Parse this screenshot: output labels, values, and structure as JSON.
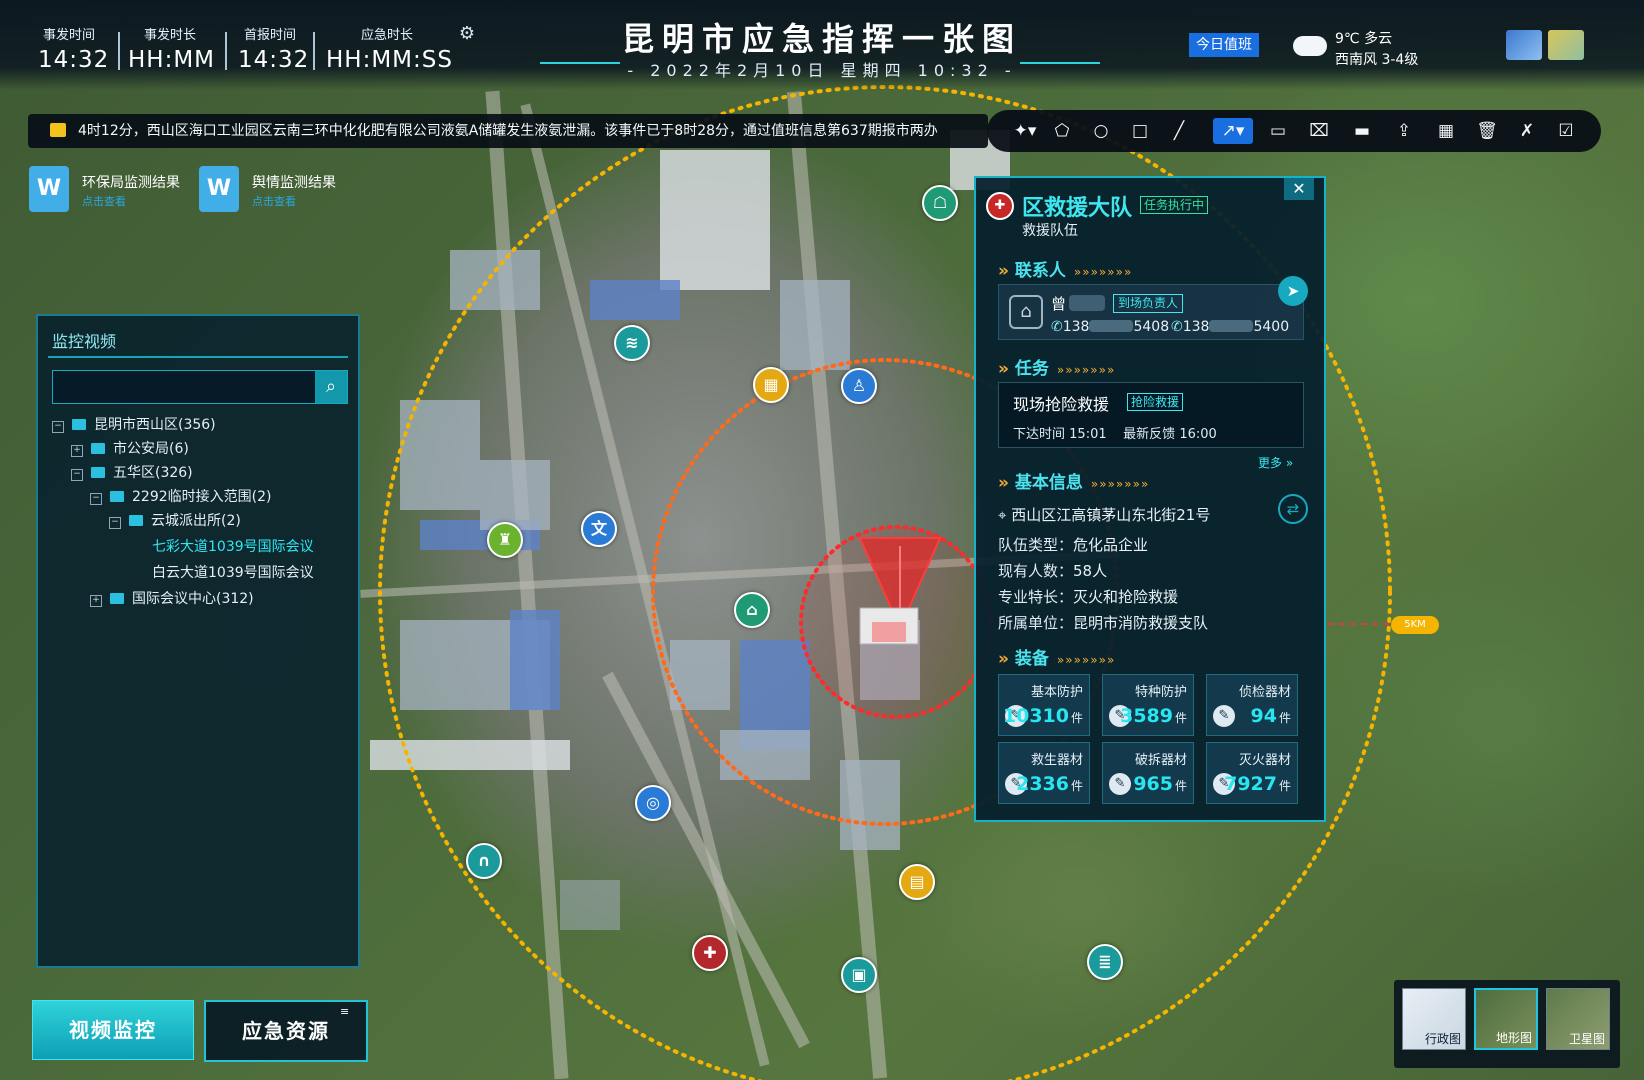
{
  "header": {
    "title": "昆明市应急指挥一张图",
    "date": "- 2022年2月10日 星期四 10:32 -",
    "stats": [
      {
        "label": "事发时间",
        "value": "14:32"
      },
      {
        "label": "事发时长",
        "value": "HH:MM"
      },
      {
        "label": "首报时间",
        "value": "14:32"
      },
      {
        "label": "应急时长",
        "value": "HH:MM:SS"
      }
    ],
    "duty_button": "今日值班",
    "weather_line1": "9℃ 多云",
    "weather_line2": "西南风 3-4级"
  },
  "ticker": {
    "icon": "alert-message-icon",
    "text": "4时12分，西山区海口工业园区云南三环中化化肥有限公司液氨A储罐发生液氨泄漏。该事件已于8时28分，通过值班信息第637期报市两办"
  },
  "docs": [
    {
      "title": "环保局监测结果",
      "link": "点击查看"
    },
    {
      "title": "舆情监测结果",
      "link": "点击查看"
    }
  ],
  "toolbar": {
    "icons": [
      "pin-icon",
      "polygon-icon",
      "circle-icon",
      "rectangle-icon",
      "line-icon",
      "arrow-icon",
      "text-box-icon",
      "clear-icon",
      "ruler-icon",
      "export-icon",
      "grid-icon",
      "delete-icon",
      "delete-all-icon",
      "confirm-icon"
    ]
  },
  "left_panel": {
    "title": "监控视频",
    "search_placeholder": "",
    "tree": [
      {
        "label": "昆明市西山区(356)",
        "level": 0,
        "expanded": true
      },
      {
        "label": "市公安局(6)",
        "level": 1,
        "expanded": false
      },
      {
        "label": "五华区(326)",
        "level": 1,
        "expanded": true
      },
      {
        "label": "2292临时接入范围(2)",
        "level": 2,
        "expanded": true
      },
      {
        "label": "云城派出所(2)",
        "level": 3,
        "expanded": true
      },
      {
        "label": "七彩大道1039号国际会议",
        "level": 4,
        "selected": true
      },
      {
        "label": "白云大道1039号国际会议",
        "level": 4
      },
      {
        "label": "国际会议中心(312)",
        "level": 2,
        "expanded": false
      }
    ]
  },
  "bottom_buttons": {
    "video": "视频监控",
    "resources": "应急资源"
  },
  "map": {
    "radius_label": "5KM",
    "poi_icons": [
      "team-icon",
      "water-icon",
      "factory-icon",
      "person-icon",
      "hydrant-icon",
      "culture-icon",
      "warehouse-icon",
      "sports-icon",
      "tunnel-icon",
      "factory-icon",
      "medical-icon",
      "bus-icon",
      "reservoir-icon"
    ]
  },
  "team_panel": {
    "name": "区救援大队",
    "status": "任务执行中",
    "type": "救援队伍",
    "contact_section": "联系人",
    "contact_name": "曾",
    "contact_role": "到场负责人",
    "phone1_prefix": "138",
    "phone1_suffix": "5408",
    "phone2_prefix": "138",
    "phone2_suffix": "5400",
    "task_section": "任务",
    "task_name": "现场抢险救援",
    "task_tag": "抢险救援",
    "task_issue_label": "下达时间",
    "task_issue_time": "15:01",
    "task_feedback_label": "最新反馈",
    "task_feedback_time": "16:00",
    "more": "更多",
    "info_section": "基本信息",
    "address": "西山区江高镇茅山东北街21号",
    "fields": [
      {
        "key": "队伍类型：",
        "value": "危化品企业"
      },
      {
        "key": "现有人数：",
        "value": "58人"
      },
      {
        "key": "专业特长：",
        "value": "灭火和抢险救援"
      },
      {
        "key": "所属单位：",
        "value": "昆明市消防救援支队"
      }
    ],
    "equip_section": "装备",
    "equipment": [
      {
        "name": "基本防护",
        "value": "10310",
        "unit": "件"
      },
      {
        "name": "特种防护",
        "value": "3589",
        "unit": "件"
      },
      {
        "name": "侦检器材",
        "value": "94",
        "unit": "件"
      },
      {
        "name": "救生器材",
        "value": "2336",
        "unit": "件"
      },
      {
        "name": "破拆器材",
        "value": "965",
        "unit": "件"
      },
      {
        "name": "灭火器材",
        "value": "7927",
        "unit": "件"
      }
    ]
  },
  "map_types": [
    {
      "label": "行政图",
      "active": false
    },
    {
      "label": "地形图",
      "active": true
    },
    {
      "label": "卫星图",
      "active": false
    }
  ],
  "colors": {
    "accent": "#28e6ef",
    "orange": "#f3a93a",
    "danger": "#e53935",
    "duty_blue": "#1a6fe0"
  }
}
